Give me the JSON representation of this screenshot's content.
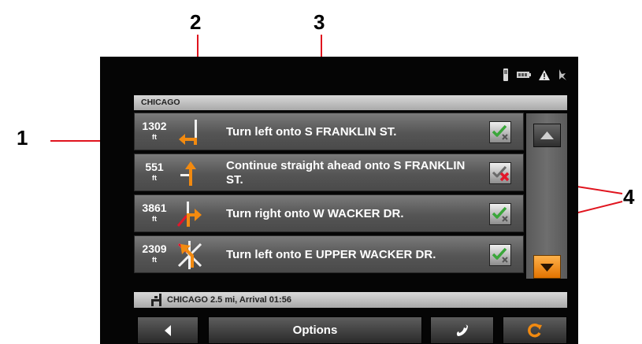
{
  "callouts": {
    "c1": "1",
    "c2": "2",
    "c3": "3",
    "c4": "4"
  },
  "status_icons": [
    "phone-signal-icon",
    "battery-icon",
    "warning-icon",
    "gps-icon"
  ],
  "city_header": "CHICAGO",
  "routes": [
    {
      "distance": "1302",
      "unit": "ft",
      "maneuver": "turn-left-icon",
      "instruction": "Turn left onto S FRANKLIN ST.",
      "included": true
    },
    {
      "distance": "551",
      "unit": "ft",
      "maneuver": "straight-ahead-icon",
      "instruction": "Continue straight ahead onto S FRANKLIN ST.",
      "included": false
    },
    {
      "distance": "3861",
      "unit": "ft",
      "maneuver": "turn-right-icon",
      "instruction": "Turn right onto W WACKER DR.",
      "included": true
    },
    {
      "distance": "2309",
      "unit": "ft",
      "maneuver": "complex-turn-left-icon",
      "instruction": "Turn left onto E UPPER WACKER DR.",
      "included": true
    }
  ],
  "summary": {
    "text": "CHICAGO 2.5 mi, Arrival 01:56",
    "icon": "destination-flag-icon"
  },
  "bottom_bar": {
    "options_label": "Options",
    "back_icon": "back-arrow-icon",
    "phone_icon": "phone-icon",
    "recalc_icon": "recalculate-icon"
  },
  "colors": {
    "accent_orange": "#f28a10",
    "check_green": "#3aa63a",
    "cross_red": "#e3162a",
    "callout_red": "#e0141e"
  }
}
